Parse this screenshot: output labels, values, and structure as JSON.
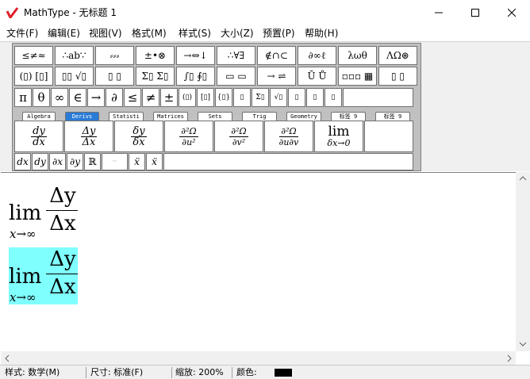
{
  "window": {
    "title": "MathType - 无标题 1"
  },
  "menu": [
    "文件(F)",
    "编辑(E)",
    "视图(V)",
    "格式(M)",
    "样式(S)",
    "大小(Z)",
    "预置(P)",
    "帮助(H)"
  ],
  "symbol_row": [
    "≤≠≈",
    "∴ab∵",
    "⸗⸗⸗",
    "±•⊗",
    "→⇔↓",
    "∴∀∃",
    "∉∩⊂",
    "∂∞ℓ",
    "λωθ",
    "ΛΩ⊛"
  ],
  "template_row": [
    "(▯) [▯]",
    "▯▯ √▯",
    "▯ ▯",
    "Σ▯ Σ▯",
    "∫▯ ∮▯",
    "▭ ▭",
    "→ ⇌",
    "Ū Ů",
    "▫▫▫ ▦",
    "▯ ▯"
  ],
  "quick_row": [
    "π",
    "θ",
    "∞",
    "∈",
    "→",
    "∂",
    "≤",
    "≠",
    "±",
    "(▯)",
    "[▯]",
    "{▯}",
    "▯",
    "Σ▯",
    "√▯",
    "▯",
    "▯",
    "▯"
  ],
  "tabs": [
    "Algebra",
    "Derivs",
    "Statisti",
    "Matrices",
    "Sets",
    "Trig",
    "Geometry",
    "标签 9",
    "标签 9"
  ],
  "active_tab": "Derivs",
  "deriv_buttons": [
    {
      "num": "dy",
      "den": "dx"
    },
    {
      "num": "Δy",
      "den": "Δx"
    },
    {
      "num": "δy",
      "den": "δx"
    },
    {
      "num": "∂²Ω",
      "den": "∂u²"
    },
    {
      "num": "∂²Ω",
      "den": "∂v²"
    },
    {
      "num": "∂²Ω",
      "den": "∂u∂v"
    },
    {
      "num": "lim",
      "den": "δx→0"
    }
  ],
  "small_buttons": [
    "dx",
    "dy",
    "∂x",
    "∂y",
    "ℝ",
    "··",
    "ẍ",
    "ẍ"
  ],
  "equation": {
    "lim": "lim",
    "sub": "x→∞",
    "num": "Δy",
    "den": "Δx"
  },
  "status": {
    "style": "样式: 数学(M)",
    "size": "尺寸: 标准(F)",
    "zoom": "缩放: 200%",
    "color_label": "颜色:",
    "color": "#000000"
  },
  "colors": {
    "highlight": "#80ffff",
    "active_tab": "#2a7bd6",
    "logo": "#e0202a"
  }
}
